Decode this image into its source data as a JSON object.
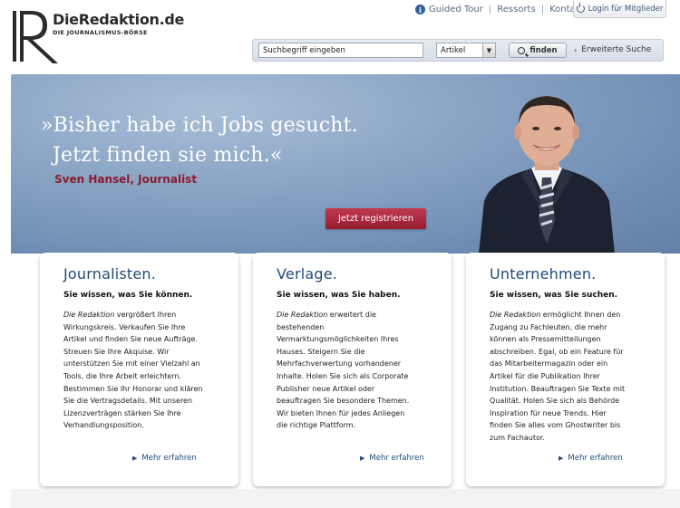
{
  "header": {
    "logo_title": "DieRedaktion.de",
    "logo_subtitle": "DIE JOURNALISMUS-BÖRSE",
    "nav": [
      {
        "label": "Guided Tour"
      },
      {
        "label": "Ressorts"
      },
      {
        "label": "Kontakt"
      }
    ],
    "login_label": "Login für Mitglieder",
    "search": {
      "value": "Suchbegriff eingeben",
      "category": "Artikel",
      "button_label": "finden",
      "advanced_label": "Erweiterte Suche"
    },
    "icons": [
      "info-icon",
      "power-icon",
      "search-icon",
      "chevron-down-icon"
    ]
  },
  "hero": {
    "quote_line1": "»Bisher habe ich Jobs gesucht.",
    "quote_line2": "Jetzt finden sie mich.«",
    "author": "Sven Hansel, Journalist",
    "cta_label": "Jetzt registrieren"
  },
  "cards": [
    {
      "title": "Journalisten.",
      "subtitle": "Sie wissen, was Sie können.",
      "lead": "Die Redaktion",
      "lines": [
        " vergrößert Ihren",
        "Wirkungskreis. Verkaufen Sie Ihre",
        "Artikel und finden Sie neue Aufträge.",
        "Streuen Sie Ihre Akquise. Wir",
        "unterstützen Sie mit einer Vielzahl an",
        "Tools, die Ihre Arbeit erleichtern.",
        "Bestimmen Sie Ihr Honorar und klären",
        "Sie die Vertragsdetails. Mit unseren",
        "Lizenzverträgen stärken Sie Ihre",
        "Verhandlungsposition."
      ],
      "more": "Mehr erfahren"
    },
    {
      "title": "Verlage.",
      "subtitle": "Sie wissen, was Sie haben.",
      "lead": "Die Redaktion",
      "lines": [
        " erweitert die",
        "bestehenden",
        "Vermarktungsmöglichkeiten Ihres",
        "Hauses. Steigern Sie die",
        "Mehrfachverwertung vorhandener",
        "Inhalte. Holen Sie sich als Corporate",
        "Publisher neue Artikel oder",
        "beauftragen Sie besondere Themen.",
        "Wir bieten Ihnen für jedes Anliegen",
        "die richtige Plattform."
      ],
      "more": "Mehr erfahren"
    },
    {
      "title": "Unternehmen.",
      "subtitle": "Sie wissen, was Sie suchen.",
      "lead": "Die Redaktion",
      "lines": [
        " ermöglicht Ihnen den",
        "Zugang zu Fachleuten, die mehr",
        "können als Pressemitteilungen",
        "abschreiben. Egal, ob ein Feature für",
        "das Mitarbeitermagazin oder ein",
        "Artikel für die Publikation Ihrer",
        "Institution. Beauftragen Sie Texte mit",
        "Qualität. Holen Sie sich als Behörde",
        "Inspiration für neue Trends. Hier",
        "finden Sie alles vom Ghostwriter bis",
        "zum Fachautor."
      ],
      "more": "Mehr erfahren"
    }
  ],
  "colors": {
    "brand_blue": "#1f4a7a",
    "cta_red": "#a52239",
    "author_red": "#8c1c2e",
    "hero_blue": "#7d98bd"
  }
}
